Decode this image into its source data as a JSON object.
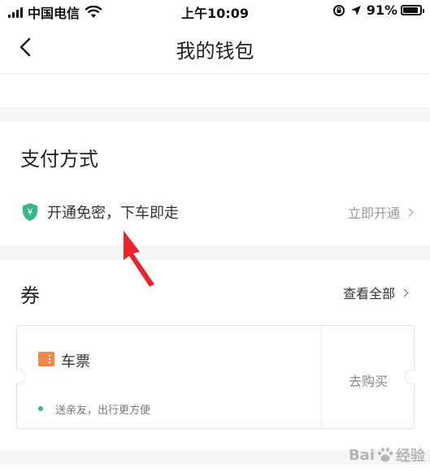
{
  "status_bar": {
    "carrier": "中国电信",
    "time": "上午10:09",
    "battery": "91%",
    "battery_level": 0.91
  },
  "nav": {
    "title": "我的钱包",
    "back_icon": "chevron-left-icon"
  },
  "payment": {
    "title": "支付方式",
    "icon": "shield-yen-icon",
    "icon_glyph": "¥",
    "description": "开通免密，下车即走",
    "action_label": "立即开通"
  },
  "coupons": {
    "title": "券",
    "view_all_label": "查看全部",
    "ticket": {
      "name": "车票",
      "description": "送亲友，出行更方便",
      "buy_label": "去购买"
    }
  },
  "watermark": {
    "left": "Bai",
    "right": "经验"
  },
  "colors": {
    "accent_green": "#35b886",
    "ticket_orange": "#f08a4c",
    "annotation_red": "#e8242c"
  }
}
